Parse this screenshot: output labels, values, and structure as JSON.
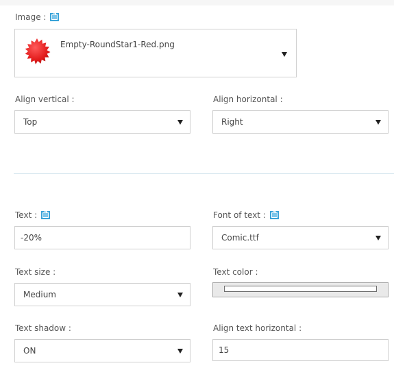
{
  "image_section": {
    "label": "Image :",
    "help_icon": "help-icon",
    "selected_file": "Empty-RoundStar1-Red.png",
    "preview_color": "#e21b1b"
  },
  "align_vertical": {
    "label": "Align vertical :",
    "value": "Top"
  },
  "align_horizontal": {
    "label": "Align horizontal :",
    "value": "Right"
  },
  "text": {
    "label": "Text :",
    "value": "-20%"
  },
  "font_of_text": {
    "label": "Font of text :",
    "value": "Comic.ttf"
  },
  "text_size": {
    "label": "Text size :",
    "value": "Medium"
  },
  "text_color": {
    "label": "Text color :",
    "value": "#ffffff"
  },
  "text_shadow": {
    "label": "Text shadow :",
    "value": "ON"
  },
  "align_text_horizontal": {
    "label": "Align text horizontal :",
    "value": "15"
  },
  "colors": {
    "help": "#3aa3d8",
    "border": "#cfcfcf",
    "divider": "#d6e6ef"
  }
}
